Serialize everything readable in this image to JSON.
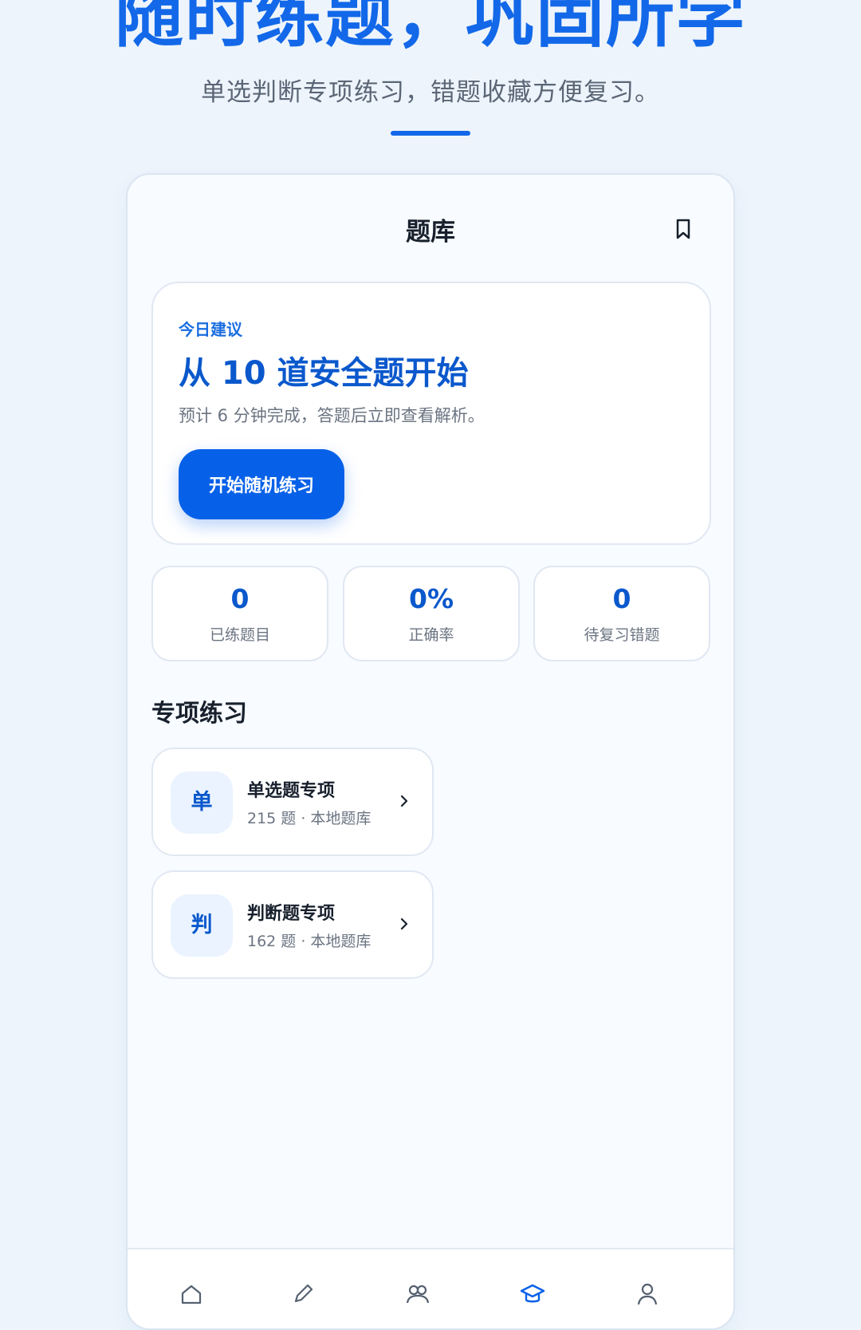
{
  "hero": {
    "title": "随时练题，巩固所学",
    "subtitle": "单选判断专项练习，错题收藏方便复习。"
  },
  "app": {
    "page_title": "题库",
    "icons": {
      "bookmark": "bookmark-icon"
    }
  },
  "today": {
    "label": "今日建议",
    "headline": "从 10 道安全题开始",
    "description": "预计 6 分钟完成，答题后立即查看解析。",
    "button_label": "开始随机练习"
  },
  "stats": [
    {
      "value": "0",
      "label": "已练题目"
    },
    {
      "value": "0%",
      "label": "正确率"
    },
    {
      "value": "0",
      "label": "待复习错题"
    }
  ],
  "practice": {
    "section_title": "专项练习",
    "items": [
      {
        "icon_text": "单",
        "title": "单选题专项",
        "subtitle": "215 题 · 本地题库"
      },
      {
        "icon_text": "判",
        "title": "判断题专项",
        "subtitle": "162 题 · 本地题库"
      }
    ]
  },
  "nav": {
    "icons": [
      "home-icon",
      "edit-icon",
      "community-icon",
      "study-icon",
      "profile-icon"
    ],
    "active_index": 3
  },
  "colors": {
    "accent": "#0761e8",
    "background": "#edf4fc",
    "text_primary": "#17202c",
    "text_secondary": "#6b7482"
  }
}
